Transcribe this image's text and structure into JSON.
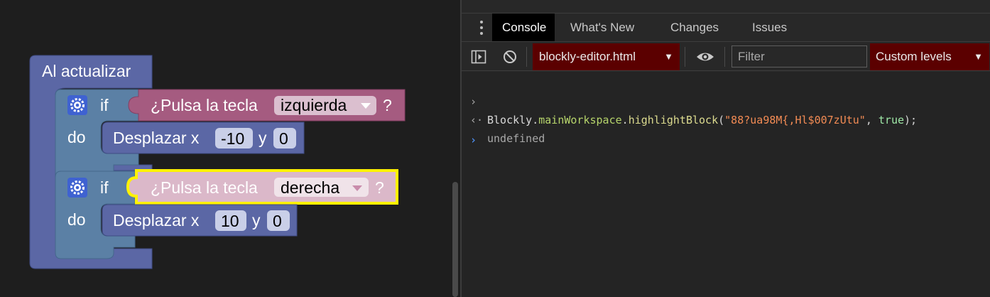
{
  "workspace": {
    "event_block": {
      "label": "Al actualizar"
    },
    "if_blocks": [
      {
        "if_label": "if",
        "do_label": "do",
        "condition": {
          "prefix": "¿Pulsa la tecla",
          "key": "izquierda",
          "suffix": "?",
          "selected": false
        },
        "move": {
          "label": "Desplazar x",
          "x": "-10",
          "y_label": "y",
          "y": "0"
        }
      },
      {
        "if_label": "if",
        "do_label": "do",
        "condition": {
          "prefix": "¿Pulsa la tecla",
          "key": "derecha",
          "suffix": "?",
          "selected": true
        },
        "move": {
          "label": "Desplazar x",
          "x": "10",
          "y_label": "y",
          "y": "0"
        }
      }
    ],
    "colors": {
      "event_block": "#5b67a5",
      "logic_block": "#5b80a5",
      "motion_block": "#5b67a5",
      "sensing_block": "#a55b80",
      "highlight": "#fff200"
    }
  },
  "devtools": {
    "tabs": [
      {
        "label": "Console",
        "active": true
      },
      {
        "label": "What's New",
        "active": false
      },
      {
        "label": "Changes",
        "active": false
      },
      {
        "label": "Issues",
        "active": false
      }
    ],
    "toolbar": {
      "context": "blockly-editor.html",
      "filter_placeholder": "Filter",
      "levels": "Custom levels"
    },
    "console": {
      "input": {
        "object": "Blockly",
        "property": "mainWorkspace",
        "method": "highlightBlock",
        "arg_string": "\"88?ua98M{,Hl$007zUtu\"",
        "arg_bool": "true"
      },
      "result": "undefined"
    }
  }
}
